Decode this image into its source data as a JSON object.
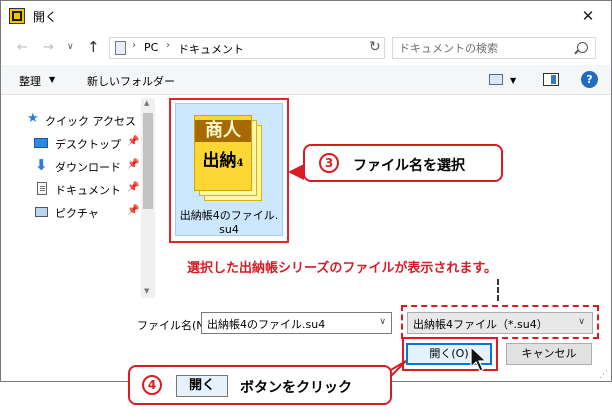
{
  "window": {
    "title": "開く",
    "close_glyph": "✕"
  },
  "nav": {
    "back_glyph": "←",
    "forward_glyph": "→",
    "history_glyph": "∨",
    "up_glyph": "↑",
    "address_sep": "›",
    "address_parts": [
      "PC",
      "ドキュメント"
    ],
    "address_dropdown_glyph": "∨",
    "refresh_glyph": "↻",
    "search_placeholder": "ドキュメントの検索"
  },
  "toolbar": {
    "organize_label": "整理",
    "organize_caret": "▼",
    "new_folder_label": "新しいフォルダー",
    "view_caret": "▼",
    "help_label": "?"
  },
  "sidebar": {
    "pin_glyph": "📌",
    "items": [
      {
        "label": "クイック アクセス",
        "icon": "star-icon"
      },
      {
        "label": "デスクトップ",
        "icon": "desktop-icon"
      },
      {
        "label": "ダウンロード",
        "icon": "download-icon"
      },
      {
        "label": "ドキュメント",
        "icon": "document-icon"
      },
      {
        "label": "ピクチャ",
        "icon": "picture-icon"
      }
    ],
    "scroll_up_glyph": "▲",
    "scroll_down_glyph": "▼"
  },
  "file": {
    "name_line1": "出納帳4のファイル.",
    "name_line2": "su4",
    "icon_band_text": "商人",
    "icon_sub_text": "出納",
    "icon_sub_num": "4"
  },
  "callouts": {
    "step3_num": "3",
    "step3_text": "ファイル名を選択",
    "annotation": "選択した出納帳シリーズのファイルが表示されます。",
    "step4_num": "4",
    "step4_button": "開く",
    "step4_text": "ボタンをクリック"
  },
  "bottom": {
    "filename_label": "ファイル名(N):",
    "filename_value": "出納帳4のファイル.su4",
    "dropdown_glyph": "∨",
    "filter_value": "出納帳4ファイル（*.su4）",
    "open_label": "開く(O)",
    "cancel_label": "キャンセル"
  },
  "colors": {
    "accent": "#0078d7",
    "callout_red": "#d91c24",
    "selection": "#cce8ff"
  }
}
